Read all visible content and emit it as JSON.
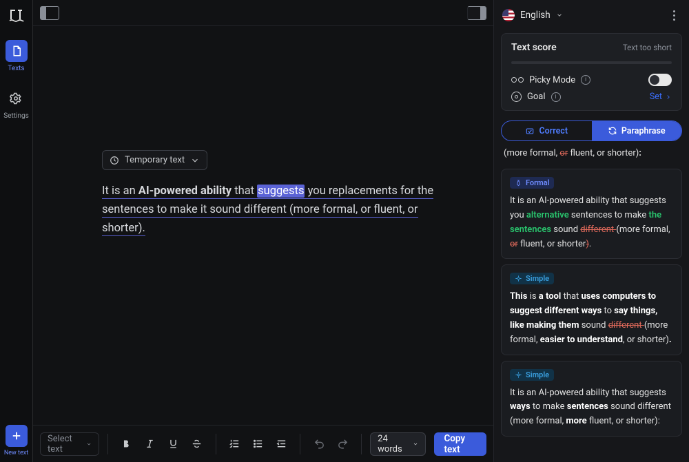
{
  "rail": {
    "texts": {
      "label": "Texts"
    },
    "settings": {
      "label": "Settings"
    },
    "new": {
      "label": "New text"
    }
  },
  "editor": {
    "temp_chip": "Temporary text",
    "content": {
      "prefix": "It is an ",
      "bold1": "AI-powered ability",
      "mid1": " that ",
      "selected": "suggests",
      "rest": " you replacements for the sentences to make it sound different (more formal, or fluent, or shorter)."
    }
  },
  "bottom": {
    "select": "Select text",
    "words": "24 words",
    "copy": "Copy text"
  },
  "right": {
    "language": "English",
    "score_title": "Text score",
    "score_note": "Text too short",
    "picky": "Picky Mode",
    "goal": "Goal",
    "set": "Set",
    "tabs": {
      "correct": "Correct",
      "paraphrase": "Paraphrase"
    },
    "frag_top": "(more formal, or fluent, or shorter):",
    "frag_top_strike": "or",
    "cards": {
      "formal": {
        "badge": "Formal",
        "t1": "It is an AI-powered ability that suggests you ",
        "ins1": "alternative",
        "t2": " sentences to make ",
        "ins2": "the sentences",
        "t3": " sound ",
        "del1": "different ",
        "t4": "(more formal, ",
        "del2": "or",
        "t5": " fluent, or shorter",
        "del3": ")",
        "t6": "."
      },
      "simple1": {
        "badge": "Simple",
        "b1": "This",
        "t1": " is ",
        "b2": "a tool",
        "t2": " that ",
        "b3": "uses computers to suggest different ways",
        "t3": " to ",
        "b4": "say things, like making them",
        "t4": " sound ",
        "del1": "different ",
        "t5": "(more formal, ",
        "b5": "easier to understand",
        "t6": ", or shorter)",
        "b6": "."
      },
      "simple2": {
        "badge": "Simple",
        "t1": "It is an AI-powered ability that suggests ",
        "b1": "ways",
        "t2": " to make ",
        "b2": "sentences",
        "t3": " sound different (more formal, ",
        "b3": "more",
        "t4": " fluent, or shorter):"
      }
    }
  }
}
